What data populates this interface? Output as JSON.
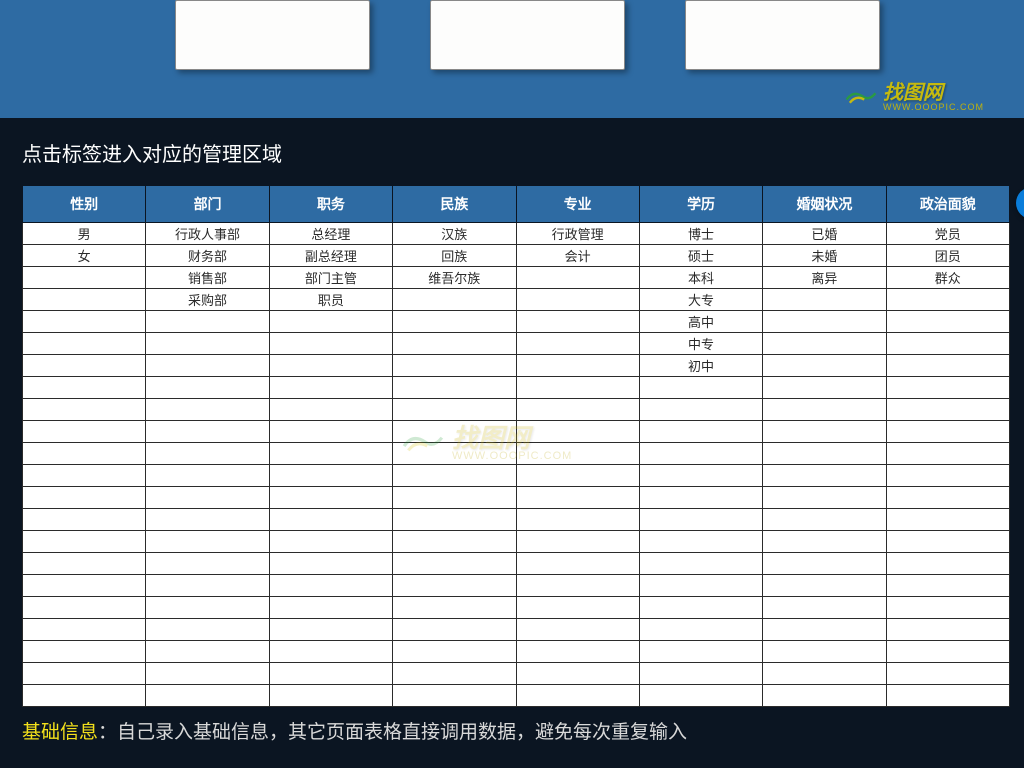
{
  "watermark": {
    "brand": "找图网",
    "url": "WWW.OOOPIC.COM"
  },
  "instruction": "点击标签进入对应的管理区域",
  "table": {
    "headers": [
      "性别",
      "部门",
      "职务",
      "民族",
      "专业",
      "学历",
      "婚姻状况",
      "政治面貌"
    ],
    "rows": [
      [
        "男",
        "行政人事部",
        "总经理",
        "汉族",
        "行政管理",
        "博士",
        "已婚",
        "党员"
      ],
      [
        "女",
        "财务部",
        "副总经理",
        "回族",
        "会计",
        "硕士",
        "未婚",
        "团员"
      ],
      [
        "",
        "销售部",
        "部门主管",
        "维吾尔族",
        "",
        "本科",
        "离异",
        "群众"
      ],
      [
        "",
        "采购部",
        "职员",
        "",
        "",
        "大专",
        "",
        ""
      ],
      [
        "",
        "",
        "",
        "",
        "",
        "高中",
        "",
        ""
      ],
      [
        "",
        "",
        "",
        "",
        "",
        "中专",
        "",
        ""
      ],
      [
        "",
        "",
        "",
        "",
        "",
        "初中",
        "",
        ""
      ],
      [
        "",
        "",
        "",
        "",
        "",
        "",
        "",
        ""
      ],
      [
        "",
        "",
        "",
        "",
        "",
        "",
        "",
        ""
      ],
      [
        "",
        "",
        "",
        "",
        "",
        "",
        "",
        ""
      ],
      [
        "",
        "",
        "",
        "",
        "",
        "",
        "",
        ""
      ],
      [
        "",
        "",
        "",
        "",
        "",
        "",
        "",
        ""
      ],
      [
        "",
        "",
        "",
        "",
        "",
        "",
        "",
        ""
      ],
      [
        "",
        "",
        "",
        "",
        "",
        "",
        "",
        ""
      ],
      [
        "",
        "",
        "",
        "",
        "",
        "",
        "",
        ""
      ],
      [
        "",
        "",
        "",
        "",
        "",
        "",
        "",
        ""
      ],
      [
        "",
        "",
        "",
        "",
        "",
        "",
        "",
        ""
      ],
      [
        "",
        "",
        "",
        "",
        "",
        "",
        "",
        ""
      ],
      [
        "",
        "",
        "",
        "",
        "",
        "",
        "",
        ""
      ],
      [
        "",
        "",
        "",
        "",
        "",
        "",
        "",
        ""
      ],
      [
        "",
        "",
        "",
        "",
        "",
        "",
        "",
        ""
      ],
      [
        "",
        "",
        "",
        "",
        "",
        "",
        "",
        ""
      ]
    ]
  },
  "footer": {
    "highlight": "基础信息",
    "sep": "：",
    "rest": "自己录入基础信息，其它页面表格直接调用数据，避免每次重复输入"
  }
}
